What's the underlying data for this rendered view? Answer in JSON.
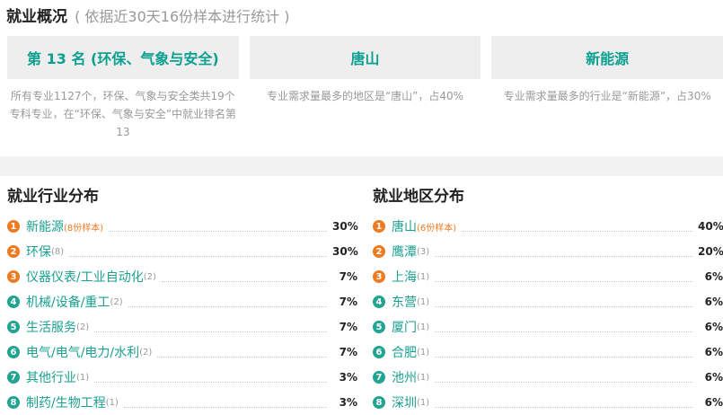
{
  "header": {
    "title": "就业概况",
    "subtitle": "( 依据近30天16份样本进行统计 )"
  },
  "stats": [
    {
      "value": "第 13 名 (环保、气象与安全)",
      "desc": "所有专业1127个，环保、气象与安全类共19个专科专业，在“环保、气象与安全”中就业排名第13"
    },
    {
      "value": "唐山",
      "desc": "专业需求量最多的地区是“唐山”，占40%"
    },
    {
      "value": "新能源",
      "desc": "专业需求量最多的行业是“新能源”，占30%"
    }
  ],
  "industry": {
    "title": "就业行业分布",
    "items": [
      {
        "rank": "1",
        "name": "新能源",
        "count": "(8份样本)",
        "pct": "30%"
      },
      {
        "rank": "2",
        "name": "环保",
        "count": "(8)",
        "pct": "30%"
      },
      {
        "rank": "3",
        "name": "仪器仪表/工业自动化",
        "count": "(2)",
        "pct": "7%"
      },
      {
        "rank": "4",
        "name": "机械/设备/重工",
        "count": "(2)",
        "pct": "7%"
      },
      {
        "rank": "5",
        "name": "生活服务",
        "count": "(2)",
        "pct": "7%"
      },
      {
        "rank": "6",
        "name": "电气/电气/电力/水利",
        "count": "(2)",
        "pct": "7%"
      },
      {
        "rank": "7",
        "name": "其他行业",
        "count": "(1)",
        "pct": "3%"
      },
      {
        "rank": "8",
        "name": "制药/生物工程",
        "count": "(1)",
        "pct": "3%"
      }
    ]
  },
  "region": {
    "title": "就业地区分布",
    "items": [
      {
        "rank": "1",
        "name": "唐山",
        "count": "(6份样本)",
        "pct": "40%"
      },
      {
        "rank": "2",
        "name": "鹰潭",
        "count": "(3)",
        "pct": "20%"
      },
      {
        "rank": "3",
        "name": "上海",
        "count": "(1)",
        "pct": "6%"
      },
      {
        "rank": "4",
        "name": "东营",
        "count": "(1)",
        "pct": "6%"
      },
      {
        "rank": "5",
        "name": "厦门",
        "count": "(1)",
        "pct": "6%"
      },
      {
        "rank": "6",
        "name": "合肥",
        "count": "(1)",
        "pct": "6%"
      },
      {
        "rank": "7",
        "name": "池州",
        "count": "(1)",
        "pct": "6%"
      },
      {
        "rank": "8",
        "name": "深圳",
        "count": "(1)",
        "pct": "6%"
      }
    ]
  },
  "colors": {
    "accent": "#0aa090",
    "rank_top": "#f07a20",
    "rank_rest": "#22a492"
  }
}
